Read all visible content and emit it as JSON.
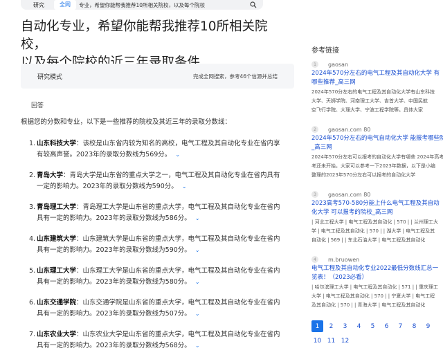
{
  "search": {
    "tabs": [
      "研究",
      "全网"
    ],
    "active_tab": 1,
    "query_fragment": "专业，希望你能帮我推荐10所相关院校，以及每个院校"
  },
  "question": {
    "line1": "自动化专业，希望你能帮我推荐10所相关院校，",
    "line2": "以及每个院校的近三年录取条件"
  },
  "mode": {
    "label": "研究模式",
    "summary": "完成全网搜索，参考46个信源并总结"
  },
  "answer": {
    "label": "回答",
    "intro": "根据您的分数和专业，以下是一些推荐的院校及其近三年的录取分数线：",
    "items": [
      {
        "num": "1.",
        "name": "山东科技大学",
        "line1": "：该校是山东省内较为知名的高校，电气工程及其自动化专业在省内享",
        "line2": "有较高声誉。2023年的录取分数线为569分。"
      },
      {
        "num": "2.",
        "name": "青岛大学",
        "line1": "：青岛大学是山东省的重点大学之一，电气工程及其自动化专业在省内具有",
        "line2": "一定的影响力。2023年的录取分数线为590分。"
      },
      {
        "num": "3.",
        "name": "青岛理工大学",
        "line1": "：青岛理工大学是山东省的重点大学，电气工程及其自动化专业在省内",
        "line2": "具有一定的影响力。2023年的录取分数线为586分。"
      },
      {
        "num": "4.",
        "name": "山东建筑大学",
        "line1": "：山东建筑大学是山东省的重点大学，电气工程及其自动化专业在省内",
        "line2": "具有一定的影响力。2023年的录取分数线为590分。"
      },
      {
        "num": "5.",
        "name": "山东理工大学",
        "line1": "：山东理工大学是山东省的重点大学，电气工程及其自动化专业在省内",
        "line2": "具有一定的影响力。2023年的录取分数线为580分。"
      },
      {
        "num": "6.",
        "name": "山东交通学院",
        "line1": "：山东交通学院是山东省的重点大学，电气工程及其自动化专业在省内",
        "line2": "具有一定的影响力。2023年的录取分数线为507分。"
      },
      {
        "num": "7.",
        "name": "山东农业大学",
        "line1": "：山东农业大学是山东省的重点大学，电气工程及其自动化专业在省内",
        "line2": "具有一定的影响力。2023年的录取分数线为568分。"
      }
    ]
  },
  "refs": {
    "title": "参考链接",
    "items": [
      {
        "n": "1",
        "source": "gaosan",
        "title1": "2024年570分左右的电气工程及其自动化大学 有",
        "title2": "哪些推荐_高三网",
        "snippet": [
          "2024年570分左右的电气工程及其自动化大学有山东科技",
          "大学、天狮学院、河南理工大学、吉首大学、中国民航",
          "空飞行学院、大理大学、宁波工程学院等。具体大家"
        ]
      },
      {
        "n": "2",
        "source": "gaosan.com 80",
        "title1": "2024年570分左右的电气自动化大学 能报考哪些院校",
        "title2": "_高三网",
        "snippet": [
          "2024年570分左右可以报考的自动化大学有哪些 2024年高考",
          "考还未开始，大家可以参考一下2023年数据，以下是小编",
          "整理的2023年570分左右可以报考的自动化大学"
        ]
      },
      {
        "n": "3",
        "source": "gaosan.com 80",
        "title1": "2023高考570-580分能上什么电气工程及其自动",
        "title2": "化大学 可以报考的院校_高三网",
        "snippet": [
          "| 河北工程大学 | 电气工程及其自动化 | 570 | | 兰州理工大",
          "学 | 电气工程及其自动化 | 570 | | 湖大学 | 电气工程及其",
          "自动化 | 569 | | 东北石油大学 | 电气工程及其自动化"
        ]
      },
      {
        "n": "4",
        "source": "m.bruowen",
        "title1": "电气工程及其自动化专业2022最低分数线汇总一",
        "title2": "览表！（2023必看）",
        "snippet": [
          "| 哈尔滨理工大学 | 电气工程及其自动化 | 571 | | 重庆理工",
          "大学 | 电气工程及其自动化 | 570 | | 宁夏大学 | 电气工程",
          "及其自动化 | 570 | | 青海大学 | 电气工程及其自动化"
        ]
      }
    ]
  },
  "pagination": {
    "pages": [
      "1",
      "2",
      "3",
      "4",
      "5",
      "6",
      "7",
      "8",
      "9",
      "10",
      "11",
      "12"
    ],
    "active_index": 0
  }
}
